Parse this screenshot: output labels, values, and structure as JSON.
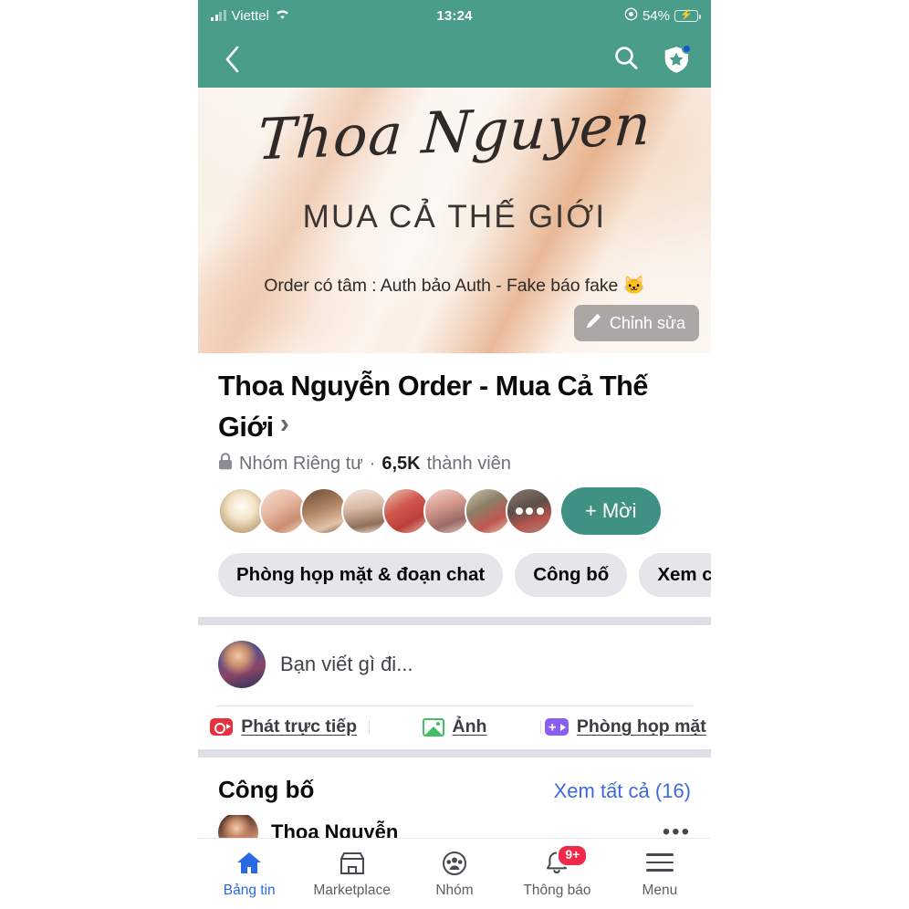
{
  "theme": {
    "header_green": "#4a9d8a",
    "invite_green": "#3f9283",
    "link_blue": "#3d6ad6",
    "active_tab_blue": "#2a6ae0",
    "badge_red": "#f02849",
    "live_red": "#e8303e",
    "photo_green": "#45bd62",
    "room_purple": "#8a5ff0"
  },
  "status_bar": {
    "carrier": "Viettel",
    "time": "13:24",
    "battery_percent": "54%",
    "battery_charging": true,
    "signal_icon": "signal-bars-icon",
    "wifi_icon": "wifi-icon",
    "location_icon": "location-arrow-icon",
    "battery_icon": "battery-charging-icon"
  },
  "nav": {
    "back_icon": "chevron-left-icon",
    "search_icon": "search-icon",
    "shield_icon": "shield-star-icon",
    "shield_has_badge": true
  },
  "cover": {
    "script_title": "Thoa Nguyen",
    "subtitle": "MUA CẢ THẾ GIỚI",
    "tagline": "Order có tâm : Auth bảo Auth - Fake báo fake 🐱",
    "edit_label": "Chỉnh sửa",
    "edit_icon": "pencil-icon"
  },
  "group": {
    "name": "Thoa Nguyễn Order - Mua Cả Thế Giới",
    "name_chevron": "›",
    "privacy_icon": "lock-icon",
    "privacy_label": "Nhóm Riêng tư",
    "separator": "·",
    "member_count": "6,5K",
    "member_word": "thành viên",
    "invite_label": "Mời",
    "invite_plus": "+",
    "more_members_icon": "ellipsis-icon"
  },
  "chips": [
    {
      "label": "Phòng họp mặt & đoạn chat"
    },
    {
      "label": "Công bố"
    },
    {
      "label": "Xem chu"
    }
  ],
  "composer": {
    "placeholder": "Bạn viết gì đi...",
    "avatar_icon": "user-avatar",
    "actions": [
      {
        "label": "Phát trực tiếp",
        "icon": "live-video-icon"
      },
      {
        "label": "Ảnh",
        "icon": "photo-icon"
      },
      {
        "label": "Phòng họp mặt",
        "icon": "video-room-icon"
      }
    ]
  },
  "announcements": {
    "title": "Công bố",
    "see_all_label": "Xem tất cả (16)",
    "peek_post": {
      "author": "Thoa Nguyễn",
      "menu_icon": "ellipsis-horizontal-icon"
    }
  },
  "tabbar": [
    {
      "label": "Bảng tin",
      "icon": "home-icon",
      "active": true,
      "badge": ""
    },
    {
      "label": "Marketplace",
      "icon": "store-icon",
      "active": false,
      "badge": ""
    },
    {
      "label": "Nhóm",
      "icon": "groups-icon",
      "active": false,
      "badge": ""
    },
    {
      "label": "Thông báo",
      "icon": "bell-icon",
      "active": false,
      "badge": "9+"
    },
    {
      "label": "Menu",
      "icon": "hamburger-menu-icon",
      "active": false,
      "badge": ""
    }
  ]
}
